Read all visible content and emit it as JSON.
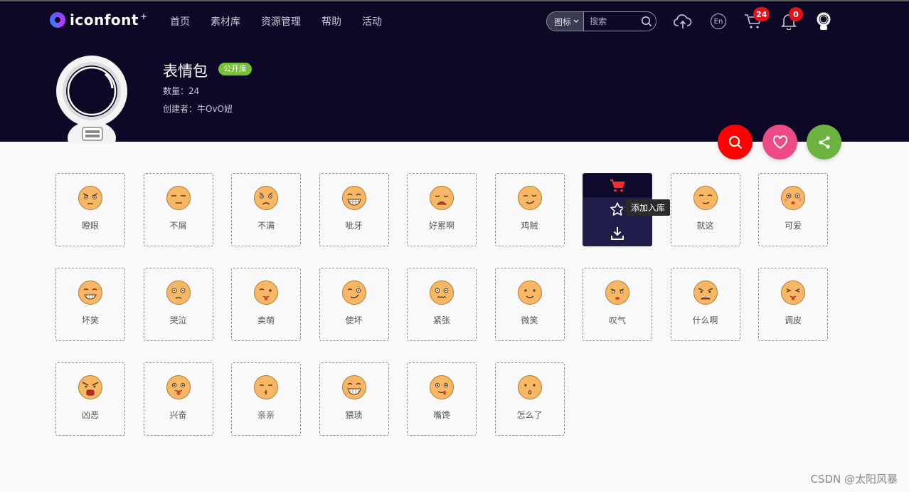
{
  "brand": {
    "logo_text": "iconfont",
    "logo_star": "+"
  },
  "nav": [
    "首页",
    "素材库",
    "资源管理",
    "帮助",
    "活动"
  ],
  "search": {
    "type_label": "图标",
    "placeholder": "搜索"
  },
  "header_icons": {
    "lang_label": "En",
    "cart_count": "24",
    "notification_count": "0"
  },
  "project": {
    "title": "表情包",
    "visibility_tag": "公开库",
    "count_label": "数量：24",
    "creator_label": "创建者：牛OvO妞"
  },
  "fabs": {
    "search_color": "#ff0000",
    "favorite_color": "#ec4c85",
    "share_color": "#6db33f"
  },
  "hover_card": {
    "tooltip": "添加入库"
  },
  "icons": [
    {
      "label": "瞪眼",
      "mood": "glare"
    },
    {
      "label": "不屑",
      "mood": "disdain"
    },
    {
      "label": "不满",
      "mood": "unhappy"
    },
    {
      "label": "呲牙",
      "mood": "grin"
    },
    {
      "label": "好累啊",
      "mood": "tired"
    },
    {
      "label": "鸡贼",
      "mood": "sly"
    },
    {
      "label": "",
      "mood": "hover"
    },
    {
      "label": "就这",
      "mood": "meh"
    },
    {
      "label": "可爱",
      "mood": "cute"
    },
    {
      "label": "坏笑",
      "mood": "evil-grin"
    },
    {
      "label": "哭泣",
      "mood": "cry"
    },
    {
      "label": "卖萌",
      "mood": "wink-tongue"
    },
    {
      "label": "使坏",
      "mood": "smirk"
    },
    {
      "label": "紧张",
      "mood": "nervous"
    },
    {
      "label": "微笑",
      "mood": "smile"
    },
    {
      "label": "叹气",
      "mood": "sigh"
    },
    {
      "label": "什么啊",
      "mood": "angry-shout"
    },
    {
      "label": "调皮",
      "mood": "naughty"
    },
    {
      "label": "凶恶",
      "mood": "fierce"
    },
    {
      "label": "兴奋",
      "mood": "excited"
    },
    {
      "label": "亲亲",
      "mood": "kiss"
    },
    {
      "label": "猥琐",
      "mood": "creepy"
    },
    {
      "label": "嘴馋",
      "mood": "greedy"
    },
    {
      "label": "怎么了",
      "mood": "puzzled"
    }
  ],
  "watermark": "CSDN @太阳风暴"
}
